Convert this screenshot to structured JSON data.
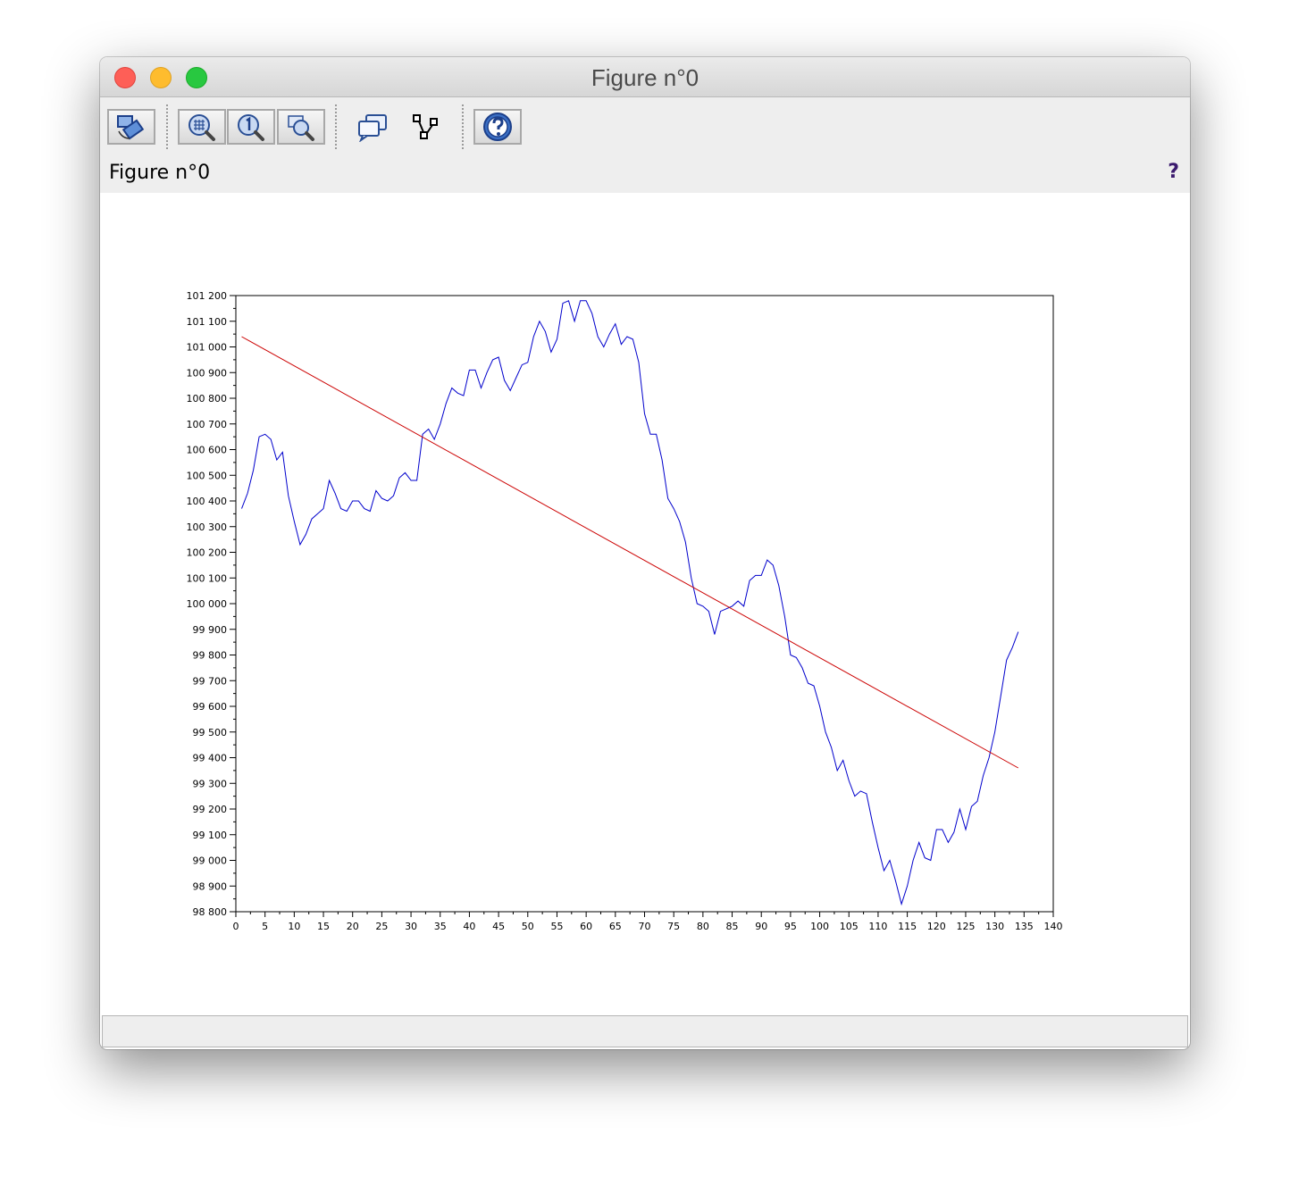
{
  "window": {
    "title": "Figure n°0"
  },
  "toolbar": {
    "buttons": [
      {
        "icon": "rotate-icon"
      },
      {
        "icon": "zoom-grid-icon"
      },
      {
        "icon": "zoom-original-icon"
      },
      {
        "icon": "zoom-select-icon"
      },
      {
        "icon": "datatip-icon"
      },
      {
        "icon": "editor-icon"
      },
      {
        "icon": "help-icon"
      }
    ]
  },
  "figure": {
    "label": "Figure n°0",
    "help": "?"
  },
  "status": {
    "text": ""
  },
  "colors": {
    "series": "#0000cc",
    "trend": "#cc0000"
  },
  "chart_data": {
    "type": "line",
    "title": "",
    "xlabel": "",
    "ylabel": "",
    "xlim": [
      0,
      140
    ],
    "ylim": [
      98800,
      101200
    ],
    "xticks": [
      0,
      5,
      10,
      15,
      20,
      25,
      30,
      35,
      40,
      45,
      50,
      55,
      60,
      65,
      70,
      75,
      80,
      85,
      90,
      95,
      100,
      105,
      110,
      115,
      120,
      125,
      130,
      135,
      140
    ],
    "xtick_labels": [
      "0",
      "5",
      "10",
      "15",
      "20",
      "25",
      "30",
      "35",
      "40",
      "45",
      "50",
      "55",
      "60",
      "65",
      "70",
      "75",
      "80",
      "85",
      "90",
      "95",
      "100",
      "105",
      "110",
      "115",
      "120",
      "125",
      "130",
      "135",
      "140"
    ],
    "yticks": [
      98800,
      98900,
      99000,
      99100,
      99200,
      99300,
      99400,
      99500,
      99600,
      99700,
      99800,
      99900,
      100000,
      100100,
      100200,
      100300,
      100400,
      100500,
      100600,
      100700,
      100800,
      100900,
      101000,
      101100,
      101200
    ],
    "ytick_labels": [
      "98 800",
      "98 900",
      "99 000",
      "99 100",
      "99 200",
      "99 300",
      "99 400",
      "99 500",
      "99 600",
      "99 700",
      "99 800",
      "99 900",
      "100 000",
      "100 100",
      "100 200",
      "100 300",
      "100 400",
      "100 500",
      "100 600",
      "100 700",
      "100 800",
      "100 900",
      "101 000",
      "101 100",
      "101 200"
    ],
    "grid": false,
    "series": [
      {
        "color": "#0000cc",
        "x": [
          1,
          2,
          3,
          4,
          5,
          6,
          7,
          8,
          9,
          10,
          11,
          12,
          13,
          14,
          15,
          16,
          17,
          18,
          19,
          20,
          21,
          22,
          23,
          24,
          25,
          26,
          27,
          28,
          29,
          30,
          31,
          32,
          33,
          34,
          35,
          36,
          37,
          38,
          39,
          40,
          41,
          42,
          43,
          44,
          45,
          46,
          47,
          48,
          49,
          50,
          51,
          52,
          53,
          54,
          55,
          56,
          57,
          58,
          59,
          60,
          61,
          62,
          63,
          64,
          65,
          66,
          67,
          68,
          69,
          70,
          71,
          72,
          73,
          74,
          75,
          76,
          77,
          78,
          79,
          80,
          81,
          82,
          83,
          84,
          85,
          86,
          87,
          88,
          89,
          90,
          91,
          92,
          93,
          94,
          95,
          96,
          97,
          98,
          99,
          100,
          101,
          102,
          103,
          104,
          105,
          106,
          107,
          108,
          109,
          110,
          111,
          112,
          113,
          114,
          115,
          116,
          117,
          118,
          119,
          120,
          121,
          122,
          123,
          124,
          125,
          126,
          127,
          128,
          129,
          130,
          131,
          132,
          133,
          134
        ],
        "values": [
          100370,
          100430,
          100520,
          100650,
          100660,
          100640,
          100560,
          100590,
          100420,
          100320,
          100230,
          100270,
          100330,
          100350,
          100370,
          100480,
          100430,
          100370,
          100360,
          100400,
          100400,
          100370,
          100360,
          100440,
          100410,
          100400,
          100420,
          100490,
          100510,
          100480,
          100480,
          100660,
          100680,
          100640,
          100700,
          100780,
          100840,
          100820,
          100810,
          100910,
          100910,
          100840,
          100900,
          100950,
          100960,
          100870,
          100830,
          100880,
          100930,
          100940,
          101040,
          101100,
          101060,
          100980,
          101030,
          101170,
          101180,
          101100,
          101180,
          101180,
          101130,
          101040,
          101000,
          101050,
          101090,
          101010,
          101040,
          101030,
          100940,
          100740,
          100660,
          100660,
          100560,
          100410,
          100370,
          100320,
          100240,
          100100,
          100000,
          99990,
          99970,
          99880,
          99970,
          99980,
          99990,
          100010,
          99990,
          100090,
          100110,
          100110,
          100170,
          100150,
          100070,
          99950,
          99800,
          99790,
          99750,
          99690,
          99680,
          99600,
          99500,
          99440,
          99350,
          99390,
          99310,
          99250,
          99270,
          99260,
          99150,
          99050,
          98960,
          99000,
          98920,
          98830,
          98900,
          99000,
          99070,
          99010,
          99000,
          99120,
          99120,
          99070,
          99110,
          99200,
          99120,
          99210,
          99230,
          99330,
          99400,
          99500,
          99640,
          99780,
          99830,
          99890
        ]
      },
      {
        "color": "#cc0000",
        "x": [
          1,
          134
        ],
        "values": [
          101040,
          99360
        ]
      }
    ]
  }
}
